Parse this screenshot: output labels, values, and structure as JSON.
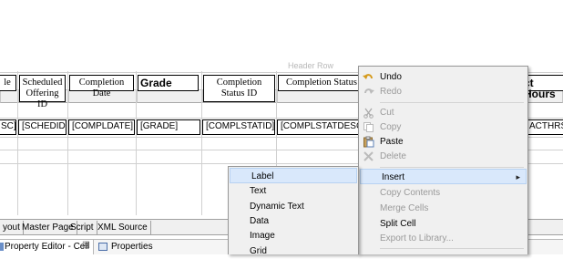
{
  "ruler": {
    "header_row_label": "Header Row"
  },
  "table": {
    "headers": [
      {
        "id": "h0",
        "label": "le"
      },
      {
        "id": "h1",
        "label": "Scheduled Offering ID"
      },
      {
        "id": "h2",
        "label": "Completion Date"
      },
      {
        "id": "h3",
        "label": "Grade"
      },
      {
        "id": "h4",
        "label": "Completion Status ID"
      },
      {
        "id": "h5",
        "label": "Completion Status"
      },
      {
        "id": "h6",
        "label": "ct Hours"
      }
    ],
    "cells": [
      "SC]",
      "[SCHEDID]",
      "[COMPLDATE]",
      "[GRADE]",
      "[COMPLSTATID]",
      "[COMPLSTATDESC",
      "ACTHRS"
    ]
  },
  "bottom_tabs": [
    "yout",
    "Master Page",
    "Script",
    "XML Source"
  ],
  "property_bar": {
    "editor_tab": "Property Editor - Cell",
    "close_glyph": "☒",
    "properties_tab": "Properties"
  },
  "context_menu": {
    "undo": "Undo",
    "redo": "Redo",
    "cut": "Cut",
    "copy": "Copy",
    "paste": "Paste",
    "delete": "Delete",
    "insert": "Insert",
    "insert_arrow": "▸",
    "copy_contents": "Copy Contents",
    "merge_cells": "Merge Cells",
    "split_cell": "Split Cell",
    "export_to_library": "Export to Library..."
  },
  "submenu": {
    "items": [
      "Label",
      "Text",
      "Dynamic Text",
      "Data",
      "Image",
      "Grid"
    ]
  },
  "colors": {
    "menu_bg": "#f0f0f0",
    "highlight": "#d9e8fb",
    "disabled": "#9a9a9a"
  }
}
